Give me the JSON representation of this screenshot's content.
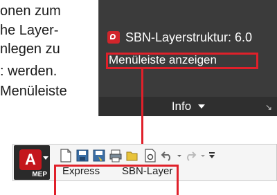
{
  "document": {
    "lines": [
      "onen zum",
      "he Layer-",
      "nlegen zu",
      ": werden.",
      "Menüleiste"
    ]
  },
  "panel": {
    "title": "SBN-Layerstruktur: 6.0",
    "menu_item": "Menüleiste anzeigen",
    "footer_label": "Info",
    "corner_glyph": "↘"
  },
  "ribbon": {
    "app_button_label": "MEP",
    "tabs": [
      "Express",
      "SBN-Layer"
    ]
  },
  "colors": {
    "highlight_red": "#e0202a",
    "panel_bg": "#3b3b3b",
    "footer_bg": "#2f2f2f",
    "autocad_red": "#c4161c"
  },
  "icons": [
    "new-file-icon",
    "save-icon",
    "save-as-icon",
    "plot-icon",
    "open-folder-icon",
    "page-setup-icon",
    "undo-icon",
    "redo-icon",
    "customize-dropdown-icon"
  ]
}
